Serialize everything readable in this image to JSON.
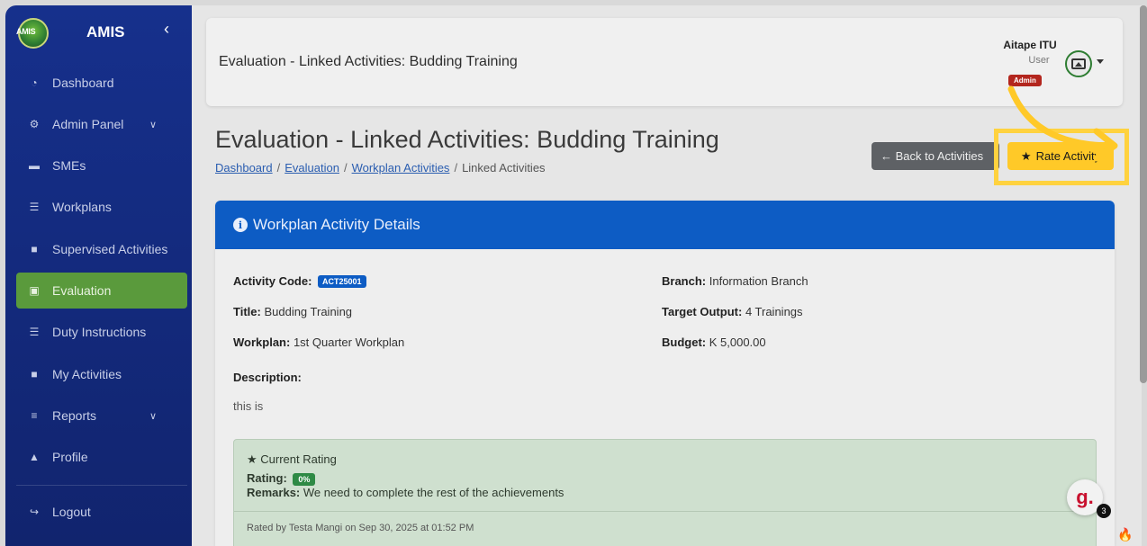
{
  "sidebar": {
    "brand": "AMIS",
    "logo_text": "AMIS",
    "items": [
      {
        "label": "Dashboard",
        "icon": "gauge-icon"
      },
      {
        "label": "Admin Panel",
        "icon": "gear-icon"
      },
      {
        "label": "SMEs",
        "icon": "box-icon"
      },
      {
        "label": "Workplans",
        "icon": "list-icon"
      },
      {
        "label": "Supervised Activities",
        "icon": "clipboard-icon"
      },
      {
        "label": "Evaluation",
        "icon": "clipboard-check-icon"
      },
      {
        "label": "Duty Instructions",
        "icon": "list-icon"
      },
      {
        "label": "My Activities",
        "icon": "clipboard-icon"
      },
      {
        "label": "Reports",
        "icon": "chart-icon"
      },
      {
        "label": "Profile",
        "icon": "user-icon"
      },
      {
        "label": "Logout",
        "icon": "logout-icon"
      }
    ]
  },
  "topbar": {
    "title": "Evaluation - Linked Activities: Budding Training",
    "user_name": "Aitape ITU",
    "user_role": "User",
    "user_badge": "Admin"
  },
  "page": {
    "heading": "Evaluation - Linked Activities: Budding Training",
    "breadcrumb": [
      "Dashboard",
      "Evaluation",
      "Workplan Activities",
      "Linked Activities"
    ],
    "back_button": "← Back to Activities",
    "rate_button": "Rate Activity"
  },
  "card": {
    "header": "Workplan Activity Details",
    "activity_code_label": "Activity Code:",
    "activity_code": "ACT25001",
    "title_label": "Title:",
    "title": "Budding Training",
    "workplan_label": "Workplan:",
    "workplan": "1st Quarter Workplan",
    "description_label": "Description:",
    "description": "this is",
    "branch_label": "Branch:",
    "branch": "Information Branch",
    "target_label": "Target Output:",
    "target": "4 Trainings",
    "budget_label": "Budget:",
    "budget": "K 5,000.00"
  },
  "rating": {
    "title": "Current Rating",
    "rating_label": "Rating:",
    "rating_value": "0%",
    "remarks_label": "Remarks:",
    "remarks": "We need to complete the rest of the achievements",
    "rated_by": "Rated by Testa Mangi on Sep 30, 2025 at 01:52 PM"
  },
  "widget": {
    "letter": "g.",
    "count": "3"
  },
  "colors": {
    "sidebar": "#16308c",
    "active": "#5a9a3c",
    "card_header": "#0d5cc4",
    "highlight": "#ffd23f",
    "rate_button": "#ffc928"
  }
}
